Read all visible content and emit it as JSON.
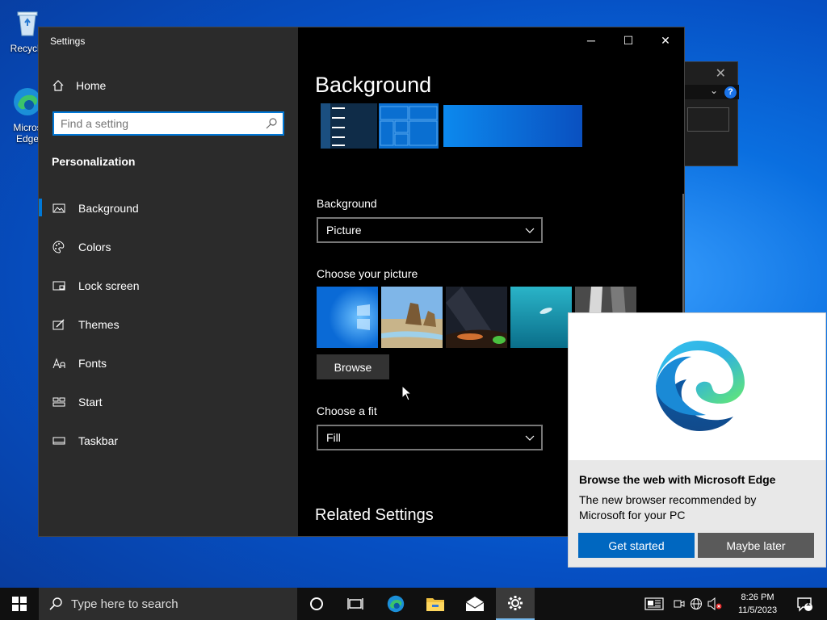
{
  "desktop": {
    "recycle_bin_label": "Recycle",
    "edge_label_1": "Micros",
    "edge_label_2": "Edge"
  },
  "settings": {
    "window_title": "Settings",
    "home_label": "Home",
    "search_placeholder": "Find a setting",
    "section_title": "Personalization",
    "nav_items": [
      {
        "label": "Background",
        "icon": "picture-icon",
        "active": true
      },
      {
        "label": "Colors",
        "icon": "palette-icon",
        "active": false
      },
      {
        "label": "Lock screen",
        "icon": "lock-screen-icon",
        "active": false
      },
      {
        "label": "Themes",
        "icon": "themes-icon",
        "active": false
      },
      {
        "label": "Fonts",
        "icon": "fonts-icon",
        "active": false
      },
      {
        "label": "Start",
        "icon": "start-icon",
        "active": false
      },
      {
        "label": "Taskbar",
        "icon": "taskbar-icon",
        "active": false
      }
    ],
    "page_title": "Background",
    "background_label": "Background",
    "background_value": "Picture",
    "choose_picture_label": "Choose your picture",
    "browse_label": "Browse",
    "choose_fit_label": "Choose a fit",
    "fit_value": "Fill",
    "related_settings": "Related Settings"
  },
  "edge_popup": {
    "heading": "Browse the web with Microsoft Edge",
    "desc": "The new browser recommended by Microsoft for your PC",
    "primary_button": "Get started",
    "secondary_button": "Maybe later"
  },
  "taskbar": {
    "search_placeholder": "Type here to search",
    "time": "8:26 PM",
    "date": "11/5/2023",
    "notification_count": "1"
  },
  "colors": {
    "accent": "#0078d7",
    "sidebar": "#2b2b2b",
    "edge_primary": "#0067c0"
  }
}
